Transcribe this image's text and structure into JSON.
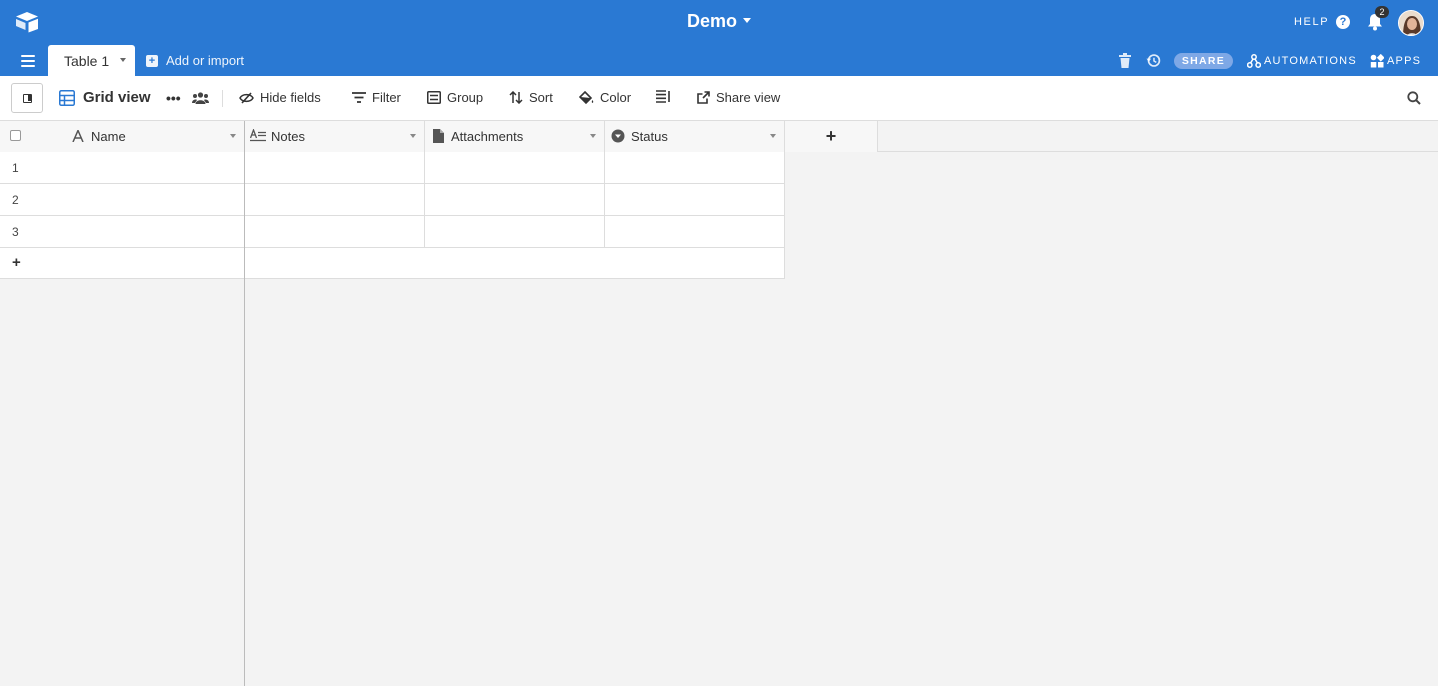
{
  "app": {
    "base_name": "Demo",
    "help_label": "HELP",
    "notification_count": "2"
  },
  "tabs": {
    "active_table": "Table 1",
    "add_or_import": "Add or import"
  },
  "top_actions": {
    "share_label": "SHARE",
    "automations_label": "AUTOMATIONS",
    "apps_label": "APPS"
  },
  "viewbar": {
    "view_name": "Grid view",
    "more_label": "•••",
    "hide_fields": "Hide fields",
    "filter": "Filter",
    "group": "Group",
    "sort": "Sort",
    "color": "Color",
    "share_view": "Share view"
  },
  "grid": {
    "columns": [
      {
        "name": "Name",
        "type": "text"
      },
      {
        "name": "Notes",
        "type": "long-text"
      },
      {
        "name": "Attachments",
        "type": "attachment"
      },
      {
        "name": "Status",
        "type": "single-select"
      }
    ],
    "rows": [
      {
        "number": "1",
        "cells": [
          "",
          "",
          "",
          ""
        ]
      },
      {
        "number": "2",
        "cells": [
          "",
          "",
          "",
          ""
        ]
      },
      {
        "number": "3",
        "cells": [
          "",
          "",
          "",
          ""
        ]
      }
    ],
    "add_row_label": "+",
    "add_field_label": "+"
  },
  "colors": {
    "topbar": "#2a79d3",
    "share_pill": "#7ea8e6",
    "grid_view_icon": "#2a79d3"
  }
}
